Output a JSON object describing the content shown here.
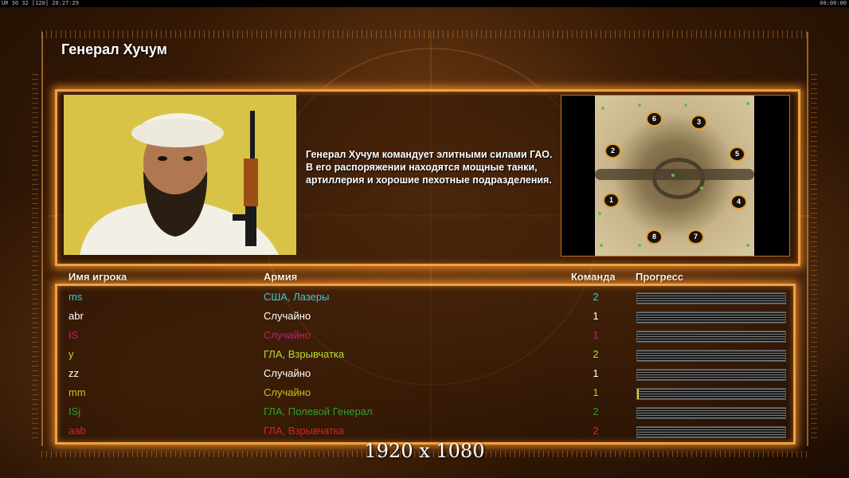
{
  "top_status": {
    "stats": "UR 30 32 [120] 20:27:29",
    "clock": "00:00:00"
  },
  "title": "Генерал Хучум",
  "description": "Генерал Хучум командует элитными силами ГАО. В его распоряжении находятся мощные танки, артиллерия и хорошие пехотные подразделения.",
  "minimap": {
    "spawns": [
      "1",
      "2",
      "3",
      "4",
      "5",
      "6",
      "7",
      "8"
    ]
  },
  "table": {
    "headers": {
      "name": "Имя игрока",
      "army": "Армия",
      "team": "Команда",
      "progress": "Прогресс"
    },
    "rows": [
      {
        "name": "ms",
        "army": "США, Лазеры",
        "team": "2",
        "color": "#3cc8d8",
        "progress": 0
      },
      {
        "name": "abr",
        "army": "Случайно",
        "team": "1",
        "color": "#ffffff",
        "progress": 0
      },
      {
        "name": "IS",
        "army": "Случайно",
        "team": "1",
        "color": "#c02070",
        "progress": 0
      },
      {
        "name": "y",
        "army": "ГЛА, Взрывчатка",
        "team": "2",
        "color": "#b8e030",
        "progress": 0
      },
      {
        "name": "zz",
        "army": "Случайно",
        "team": "1",
        "color": "#ffffff",
        "progress": 0
      },
      {
        "name": "mm",
        "army": "Случайно",
        "team": "1",
        "color": "#c8c020",
        "progress": 0.01
      },
      {
        "name": "ISj",
        "army": "ГЛА, Полевой Генерал",
        "team": "2",
        "color": "#30a030",
        "progress": 0
      },
      {
        "name": "aab",
        "army": "ГЛА, Взрывчатка",
        "team": "2",
        "color": "#e02020",
        "progress": 0
      }
    ]
  },
  "resolution_label": "1920 x 1080"
}
